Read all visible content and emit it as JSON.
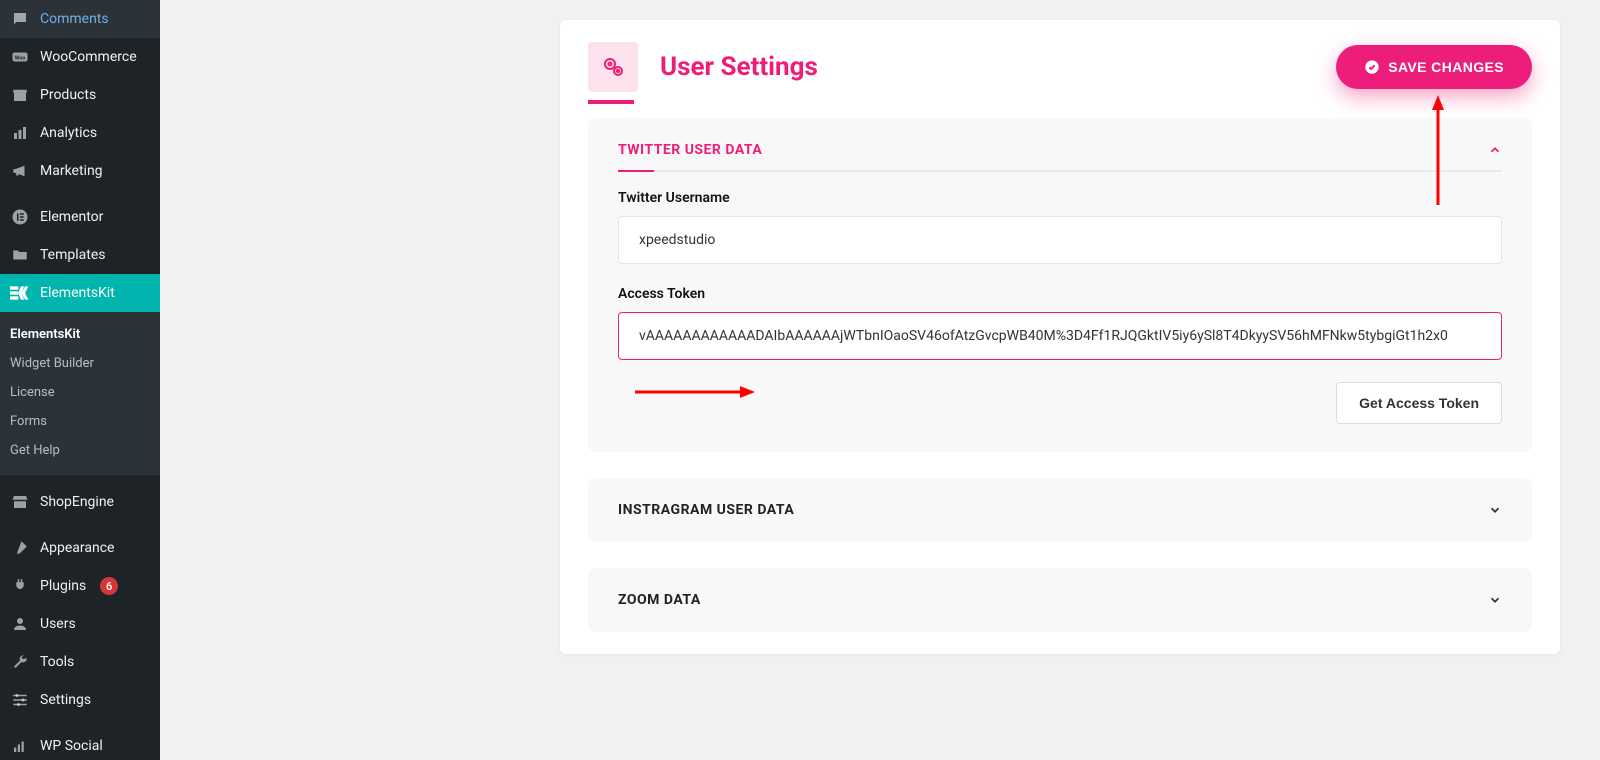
{
  "accent": "#ed1e79",
  "sidebar": {
    "items": [
      {
        "id": "comments",
        "label": "Comments",
        "icon": "comment"
      },
      {
        "id": "woocommerce",
        "label": "WooCommerce",
        "icon": "woo"
      },
      {
        "id": "products",
        "label": "Products",
        "icon": "archive"
      },
      {
        "id": "analytics",
        "label": "Analytics",
        "icon": "chart"
      },
      {
        "id": "marketing",
        "label": "Marketing",
        "icon": "megaphone"
      },
      {
        "id": "elementor",
        "label": "Elementor",
        "icon": "elementor",
        "sep": true
      },
      {
        "id": "templates",
        "label": "Templates",
        "icon": "folder"
      },
      {
        "id": "elementskit",
        "label": "ElementsKit",
        "icon": "ek",
        "active": true
      },
      {
        "id": "shopengine",
        "label": "ShopEngine",
        "icon": "store",
        "sep": true
      },
      {
        "id": "appearance",
        "label": "Appearance",
        "icon": "brush",
        "sep": true
      },
      {
        "id": "plugins",
        "label": "Plugins",
        "icon": "plug",
        "badge": "6"
      },
      {
        "id": "users",
        "label": "Users",
        "icon": "user"
      },
      {
        "id": "tools",
        "label": "Tools",
        "icon": "wrench"
      },
      {
        "id": "settings",
        "label": "Settings",
        "icon": "sliders"
      },
      {
        "id": "wpsocial",
        "label": "WP Social",
        "icon": "bars",
        "sep": true
      }
    ],
    "submenu": {
      "parent": "elementskit",
      "items": [
        {
          "label": "ElementsKit",
          "current": true
        },
        {
          "label": "Widget Builder"
        },
        {
          "label": "License"
        },
        {
          "label": "Forms"
        },
        {
          "label": "Get Help"
        }
      ]
    }
  },
  "panel": {
    "title": "User Settings",
    "save_label": "SAVE CHANGES"
  },
  "sections": {
    "twitter": {
      "title": "TWITTER USER DATA",
      "expanded": true,
      "username_label": "Twitter Username",
      "username_value": "xpeedstudio",
      "token_label": "Access Token",
      "token_value": "vAAAAAAAAAAAADAIbAAAAAAjWTbnIOaoSV46ofAtzGvcpWB40M%3D4Ff1RJQGktIV5iy6ySl8T4DkyySV56hMFNkw5tybgiGt1h2x0",
      "get_token_label": "Get Access Token"
    },
    "instagram": {
      "title": "INSTRAGRAM USER DATA"
    },
    "zoom": {
      "title": "ZOOM DATA"
    }
  }
}
